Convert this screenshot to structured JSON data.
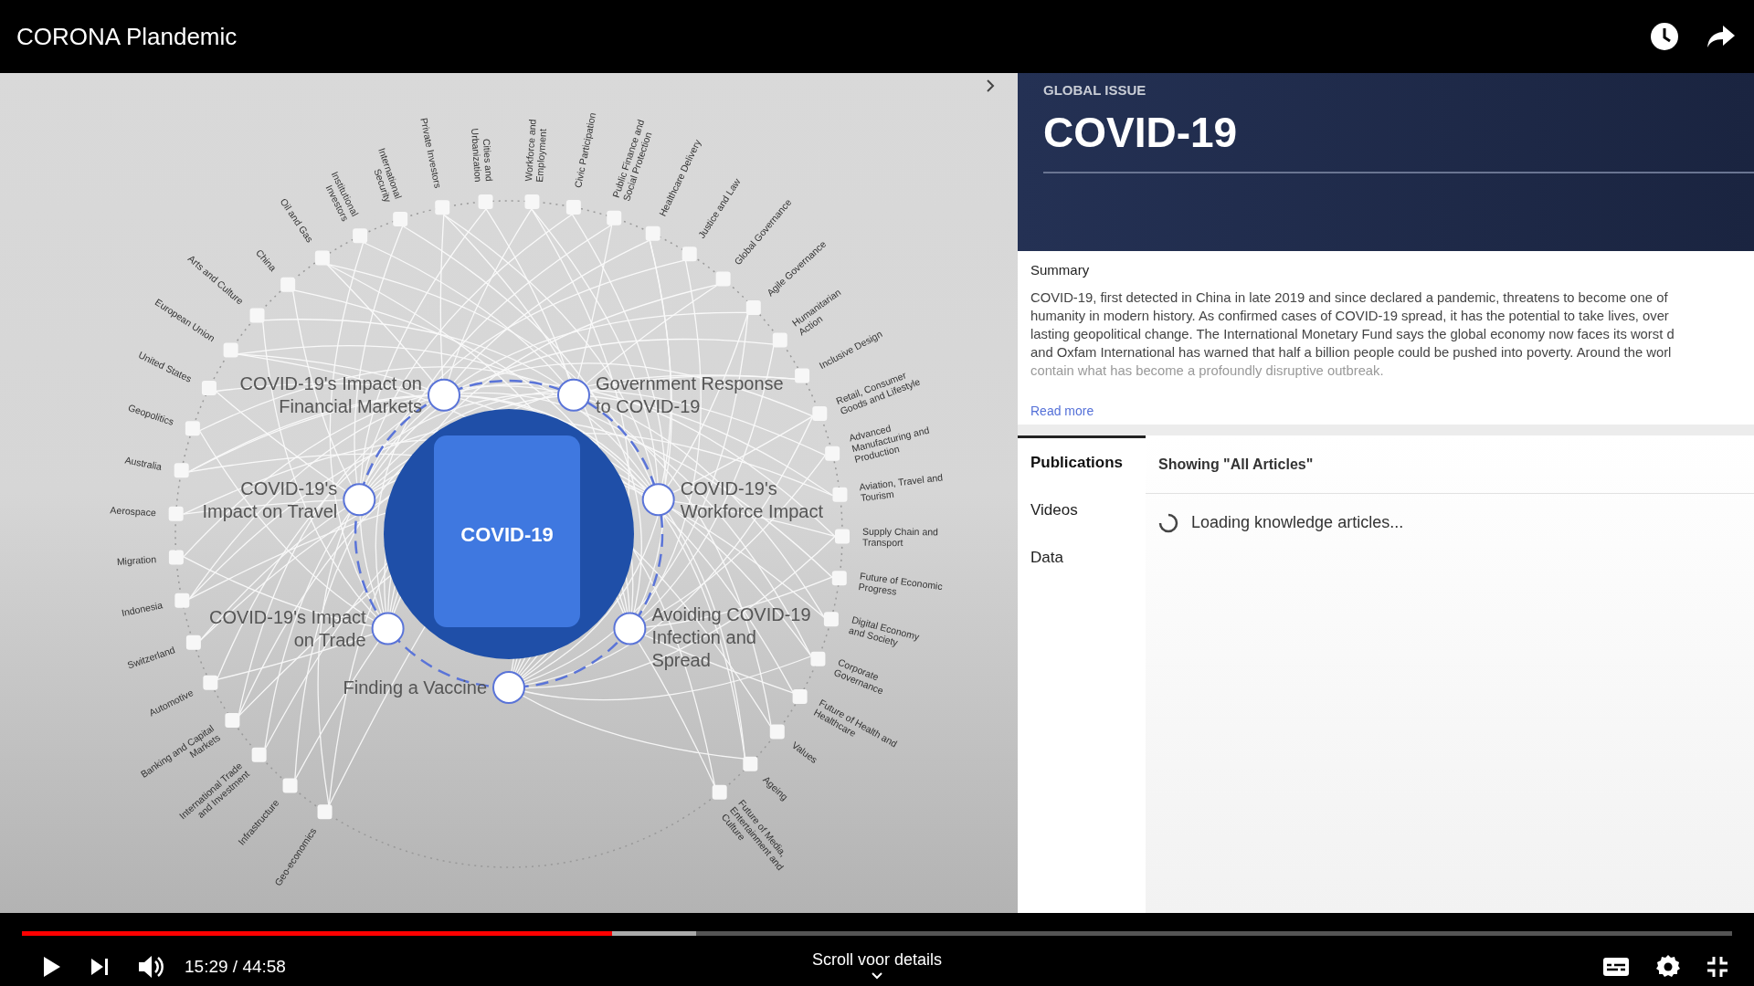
{
  "header": {
    "title": "CORONA Plandemic"
  },
  "diagram": {
    "center_label": "COVID-19",
    "hubs": [
      {
        "lines": [
          "COVID-19's Impact on",
          "Financial Markets"
        ]
      },
      {
        "lines": [
          "Government Response",
          "to COVID-19"
        ]
      },
      {
        "lines": [
          "COVID-19's",
          "Impact on Travel"
        ]
      },
      {
        "lines": [
          "COVID-19's",
          "Workforce Impact"
        ]
      },
      {
        "lines": [
          "COVID-19's Impact",
          "on Trade"
        ]
      },
      {
        "lines": [
          "Avoiding COVID-19",
          "Infection and",
          "Spread"
        ]
      },
      {
        "lines": [
          "Finding a Vaccine"
        ]
      }
    ],
    "right_arc": [
      [
        "Workforce and",
        "Employment"
      ],
      [
        "Civic Participation"
      ],
      [
        "Public Finance and",
        "Social Protection"
      ],
      [
        "Healthcare Delivery"
      ],
      [
        "Justice and Law"
      ],
      [
        "Global Governance"
      ],
      [
        "Agile Governance"
      ],
      [
        "Humanitarian",
        "Action"
      ],
      [
        "Inclusive Design"
      ],
      [
        "Retail, Consumer",
        "Goods and Lifestyle"
      ],
      [
        "Advanced",
        "Manufacturing and",
        "Production"
      ],
      [
        "Aviation, Travel and",
        "Tourism"
      ],
      [
        "Supply Chain and",
        "Transport"
      ],
      [
        "Future of Economic",
        "Progress"
      ],
      [
        "Digital Economy",
        "and Society"
      ],
      [
        "Corporate",
        "Governance"
      ],
      [
        "Future of Health and",
        "Healthcare"
      ],
      [
        "Values"
      ],
      [
        "Ageing"
      ],
      [
        "Future of Media,",
        "Entertainment and",
        "Culture"
      ]
    ],
    "left_arc": [
      [
        "Cities and",
        "Urbanization"
      ],
      [
        "Private Investors"
      ],
      [
        "International",
        "Security"
      ],
      [
        "Institutional",
        "Investors"
      ],
      [
        "Oil and Gas"
      ],
      [
        "China"
      ],
      [
        "Arts and Culture"
      ],
      [
        "European Union"
      ],
      [
        "United States"
      ],
      [
        "Geopolitics"
      ],
      [
        "Australia"
      ],
      [
        "Aerospace"
      ],
      [
        "Migration"
      ],
      [
        "Indonesia"
      ],
      [
        "Switzerland"
      ],
      [
        "Automotive"
      ],
      [
        "Banking and Capital",
        "Markets"
      ],
      [
        "International Trade",
        "and Investment"
      ],
      [
        "Infrastructure"
      ],
      [
        "Geo-economics"
      ]
    ]
  },
  "issue_panel": {
    "eyebrow": "GLOBAL ISSUE",
    "title": "COVID-19",
    "summary_heading": "Summary",
    "summary_lines": [
      "COVID-19, first detected in China in late 2019 and since declared a pandemic, threatens to become one of",
      "humanity in modern history. As confirmed cases of COVID-19 spread, it has the potential to take lives, over",
      "lasting geopolitical change. The International Monetary Fund says the global economy now faces its worst d",
      "and Oxfam International has warned that half a billion people could be pushed into poverty. Around the worl",
      "contain what has become a profoundly disruptive outbreak."
    ],
    "read_more": "Read more",
    "tabs": [
      {
        "label": "Publications",
        "selected": true
      },
      {
        "label": "Videos",
        "selected": false
      },
      {
        "label": "Data",
        "selected": false
      }
    ],
    "showing": "Showing \"All Articles\"",
    "loading": "Loading knowledge articles..."
  },
  "player": {
    "progress": {
      "level": 0.345
    },
    "time": "15:29 / 44:58",
    "scroll_hint": "Scroll voor details"
  }
}
